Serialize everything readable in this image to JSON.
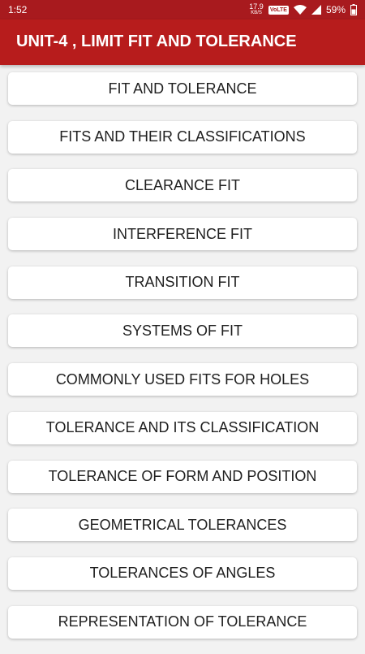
{
  "status_bar": {
    "time": "1:52",
    "speed_value": "17.9",
    "speed_unit": "KB/S",
    "volte": "VoLTE",
    "battery": "59%",
    "icons": [
      "wifi-icon",
      "signal-icon",
      "battery-icon"
    ]
  },
  "app_bar": {
    "title": "UNIT-4 , LIMIT FIT AND TOLERANCE"
  },
  "topics": [
    {
      "label": "FIT AND TOLERANCE"
    },
    {
      "label": "FITS AND THEIR CLASSIFICATIONS"
    },
    {
      "label": "CLEARANCE FIT"
    },
    {
      "label": "INTERFERENCE FIT"
    },
    {
      "label": "TRANSITION FIT"
    },
    {
      "label": "SYSTEMS OF FIT"
    },
    {
      "label": "COMMONLY USED FITS FOR HOLES"
    },
    {
      "label": "TOLERANCE AND ITS CLASSIFICATION"
    },
    {
      "label": "TOLERANCE OF FORM AND POSITION"
    },
    {
      "label": "GEOMETRICAL TOLERANCES"
    },
    {
      "label": "TOLERANCES OF ANGLES"
    },
    {
      "label": "REPRESENTATION OF TOLERANCE"
    }
  ],
  "colors": {
    "primary": "#b71c1c",
    "status_bar": "#a81a1e",
    "background": "#f2f2f2",
    "card": "#ffffff"
  }
}
